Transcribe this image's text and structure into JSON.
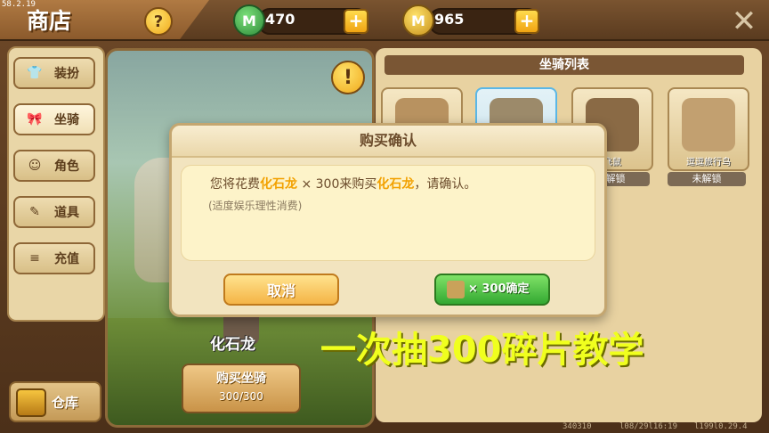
{
  "debug_overlay": "58.2.19",
  "header": {
    "title": "商店",
    "help_glyph": "?",
    "close_glyph": "✕",
    "currencies": [
      {
        "icon": "green-coin-icon",
        "value": "470",
        "color": "#3aa04a"
      },
      {
        "icon": "gold-coin-icon",
        "value": "965",
        "color": "#e5b41f"
      }
    ],
    "plus_glyph": "+"
  },
  "nav": {
    "items": [
      {
        "label": "装扮",
        "icon": "shirt-icon",
        "glyph": "👕",
        "active": false
      },
      {
        "label": "坐骑",
        "icon": "bow-icon",
        "glyph": "🎀",
        "active": true
      },
      {
        "label": "角色",
        "icon": "face-icon",
        "glyph": "☺",
        "active": false
      },
      {
        "label": "道具",
        "icon": "tool-icon",
        "glyph": "✎",
        "active": false
      },
      {
        "label": "充值",
        "icon": "coins-icon",
        "glyph": "≡",
        "active": false
      }
    ],
    "warehouse_label": "仓库"
  },
  "preview": {
    "warn_glyph": "!",
    "mount_name": "化石龙",
    "buy_label": "购买坐骑",
    "buy_cost": "300/300"
  },
  "list": {
    "header": "坐骑列表",
    "cards": [
      {
        "name": "",
        "art_color": "#b89260",
        "selected": false,
        "lock": ""
      },
      {
        "name": "",
        "art_color": "#9c8a6a",
        "selected": true,
        "lock": ""
      },
      {
        "name": "飞鼠",
        "art_color": "#8a6a45",
        "selected": false,
        "lock": "未解锁"
      },
      {
        "name": "逗逗旅行鸟",
        "art_color": "#c2a070",
        "selected": false,
        "lock": "未解锁"
      }
    ]
  },
  "modal": {
    "title": "购买确认",
    "msg_prefix": "您将花费",
    "msg_item1": "化石龙",
    "msg_qty": " × 300",
    "msg_mid": "来购买",
    "msg_item2": "化石龙",
    "msg_suffix": "，请确认。",
    "hint": "(适度娱乐理性消费)",
    "cancel_label": "取消",
    "confirm_label": "× 300确定"
  },
  "caption": "一次抽300碎片教学",
  "footer_stats": [
    "340310",
    "l08/29l16:19",
    "l199l0.29.4"
  ]
}
